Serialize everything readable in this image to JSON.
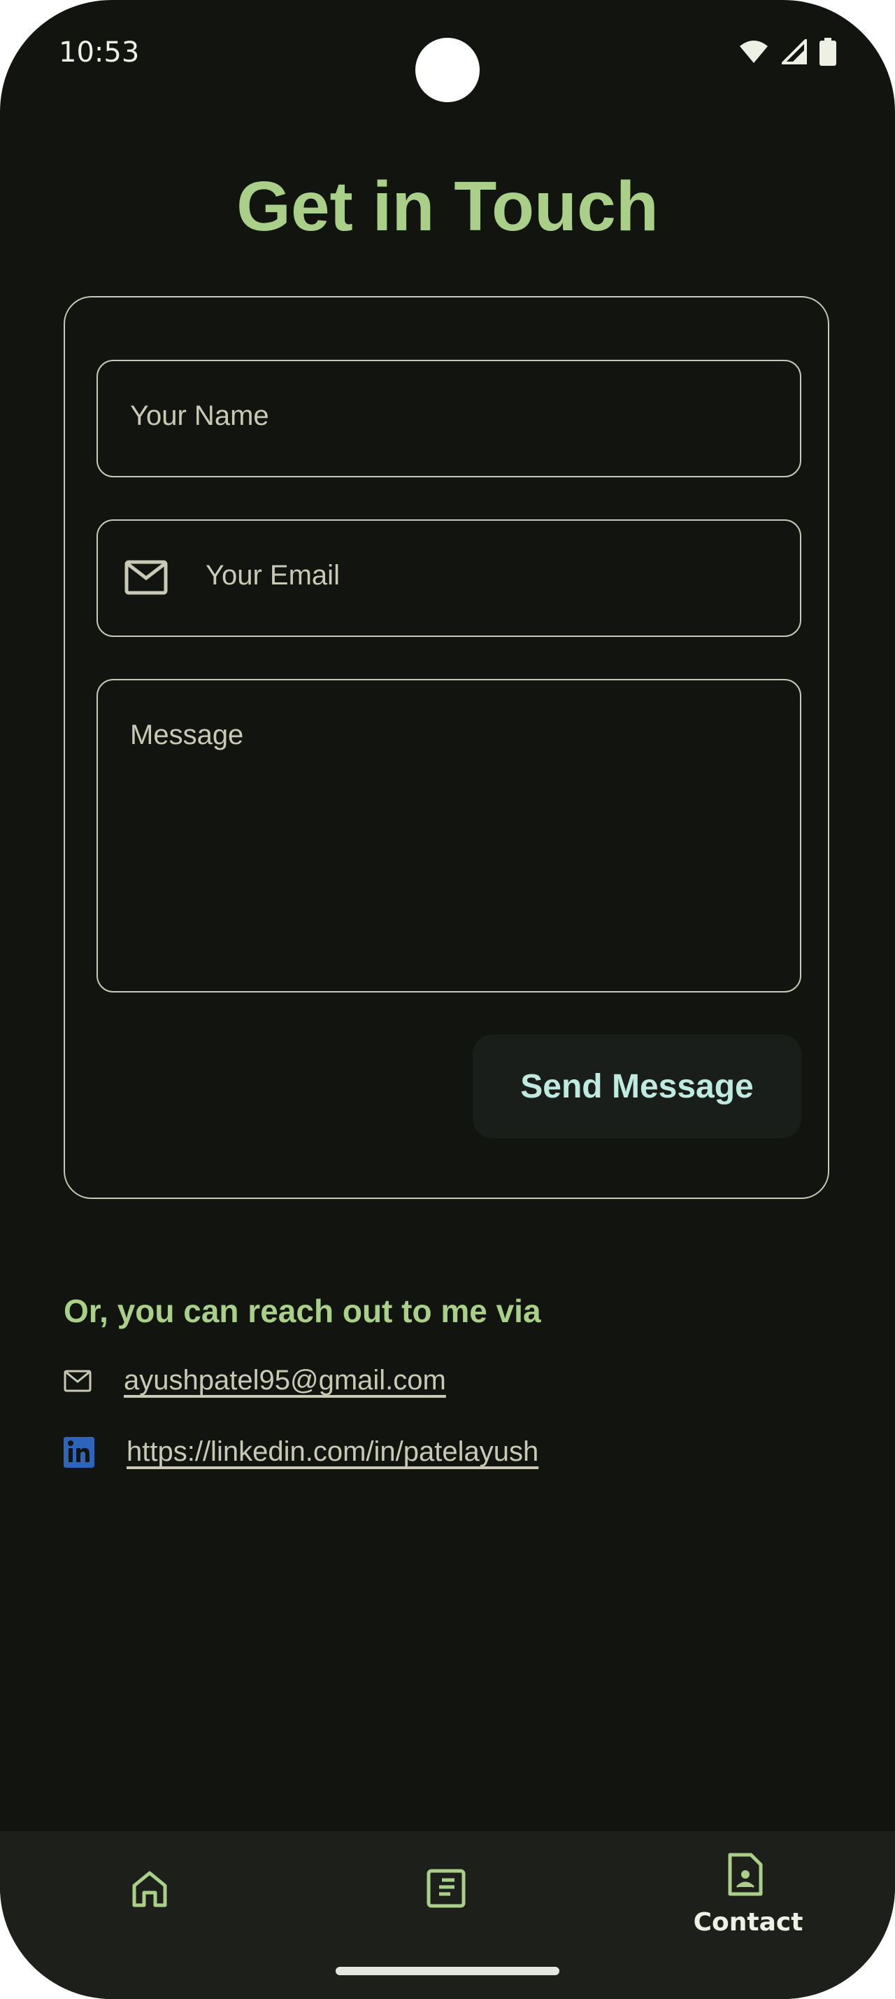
{
  "status_bar": {
    "time": "10:53",
    "icons": [
      "wifi-icon",
      "signal-icon",
      "battery-icon"
    ]
  },
  "page": {
    "title": "Get in Touch"
  },
  "form": {
    "name_placeholder": "Your Name",
    "email_placeholder": "Your Email",
    "message_placeholder": "Message",
    "send_label": "Send Message"
  },
  "reach_out": {
    "heading": "Or, you can reach out to me via",
    "email": "ayushpatel95@gmail.com",
    "linkedin": "https://linkedin.com/in/patelayush"
  },
  "bottom_nav": {
    "items": [
      {
        "icon": "home-icon",
        "label": ""
      },
      {
        "icon": "article-icon",
        "label": ""
      },
      {
        "icon": "contact-icon",
        "label": "Contact"
      }
    ]
  },
  "colors": {
    "background": "#12140f",
    "accent": "#a9cf89",
    "outline": "#c9c9b5",
    "button_text": "#bfeae0",
    "linkedin_blue": "#2d64bc"
  }
}
